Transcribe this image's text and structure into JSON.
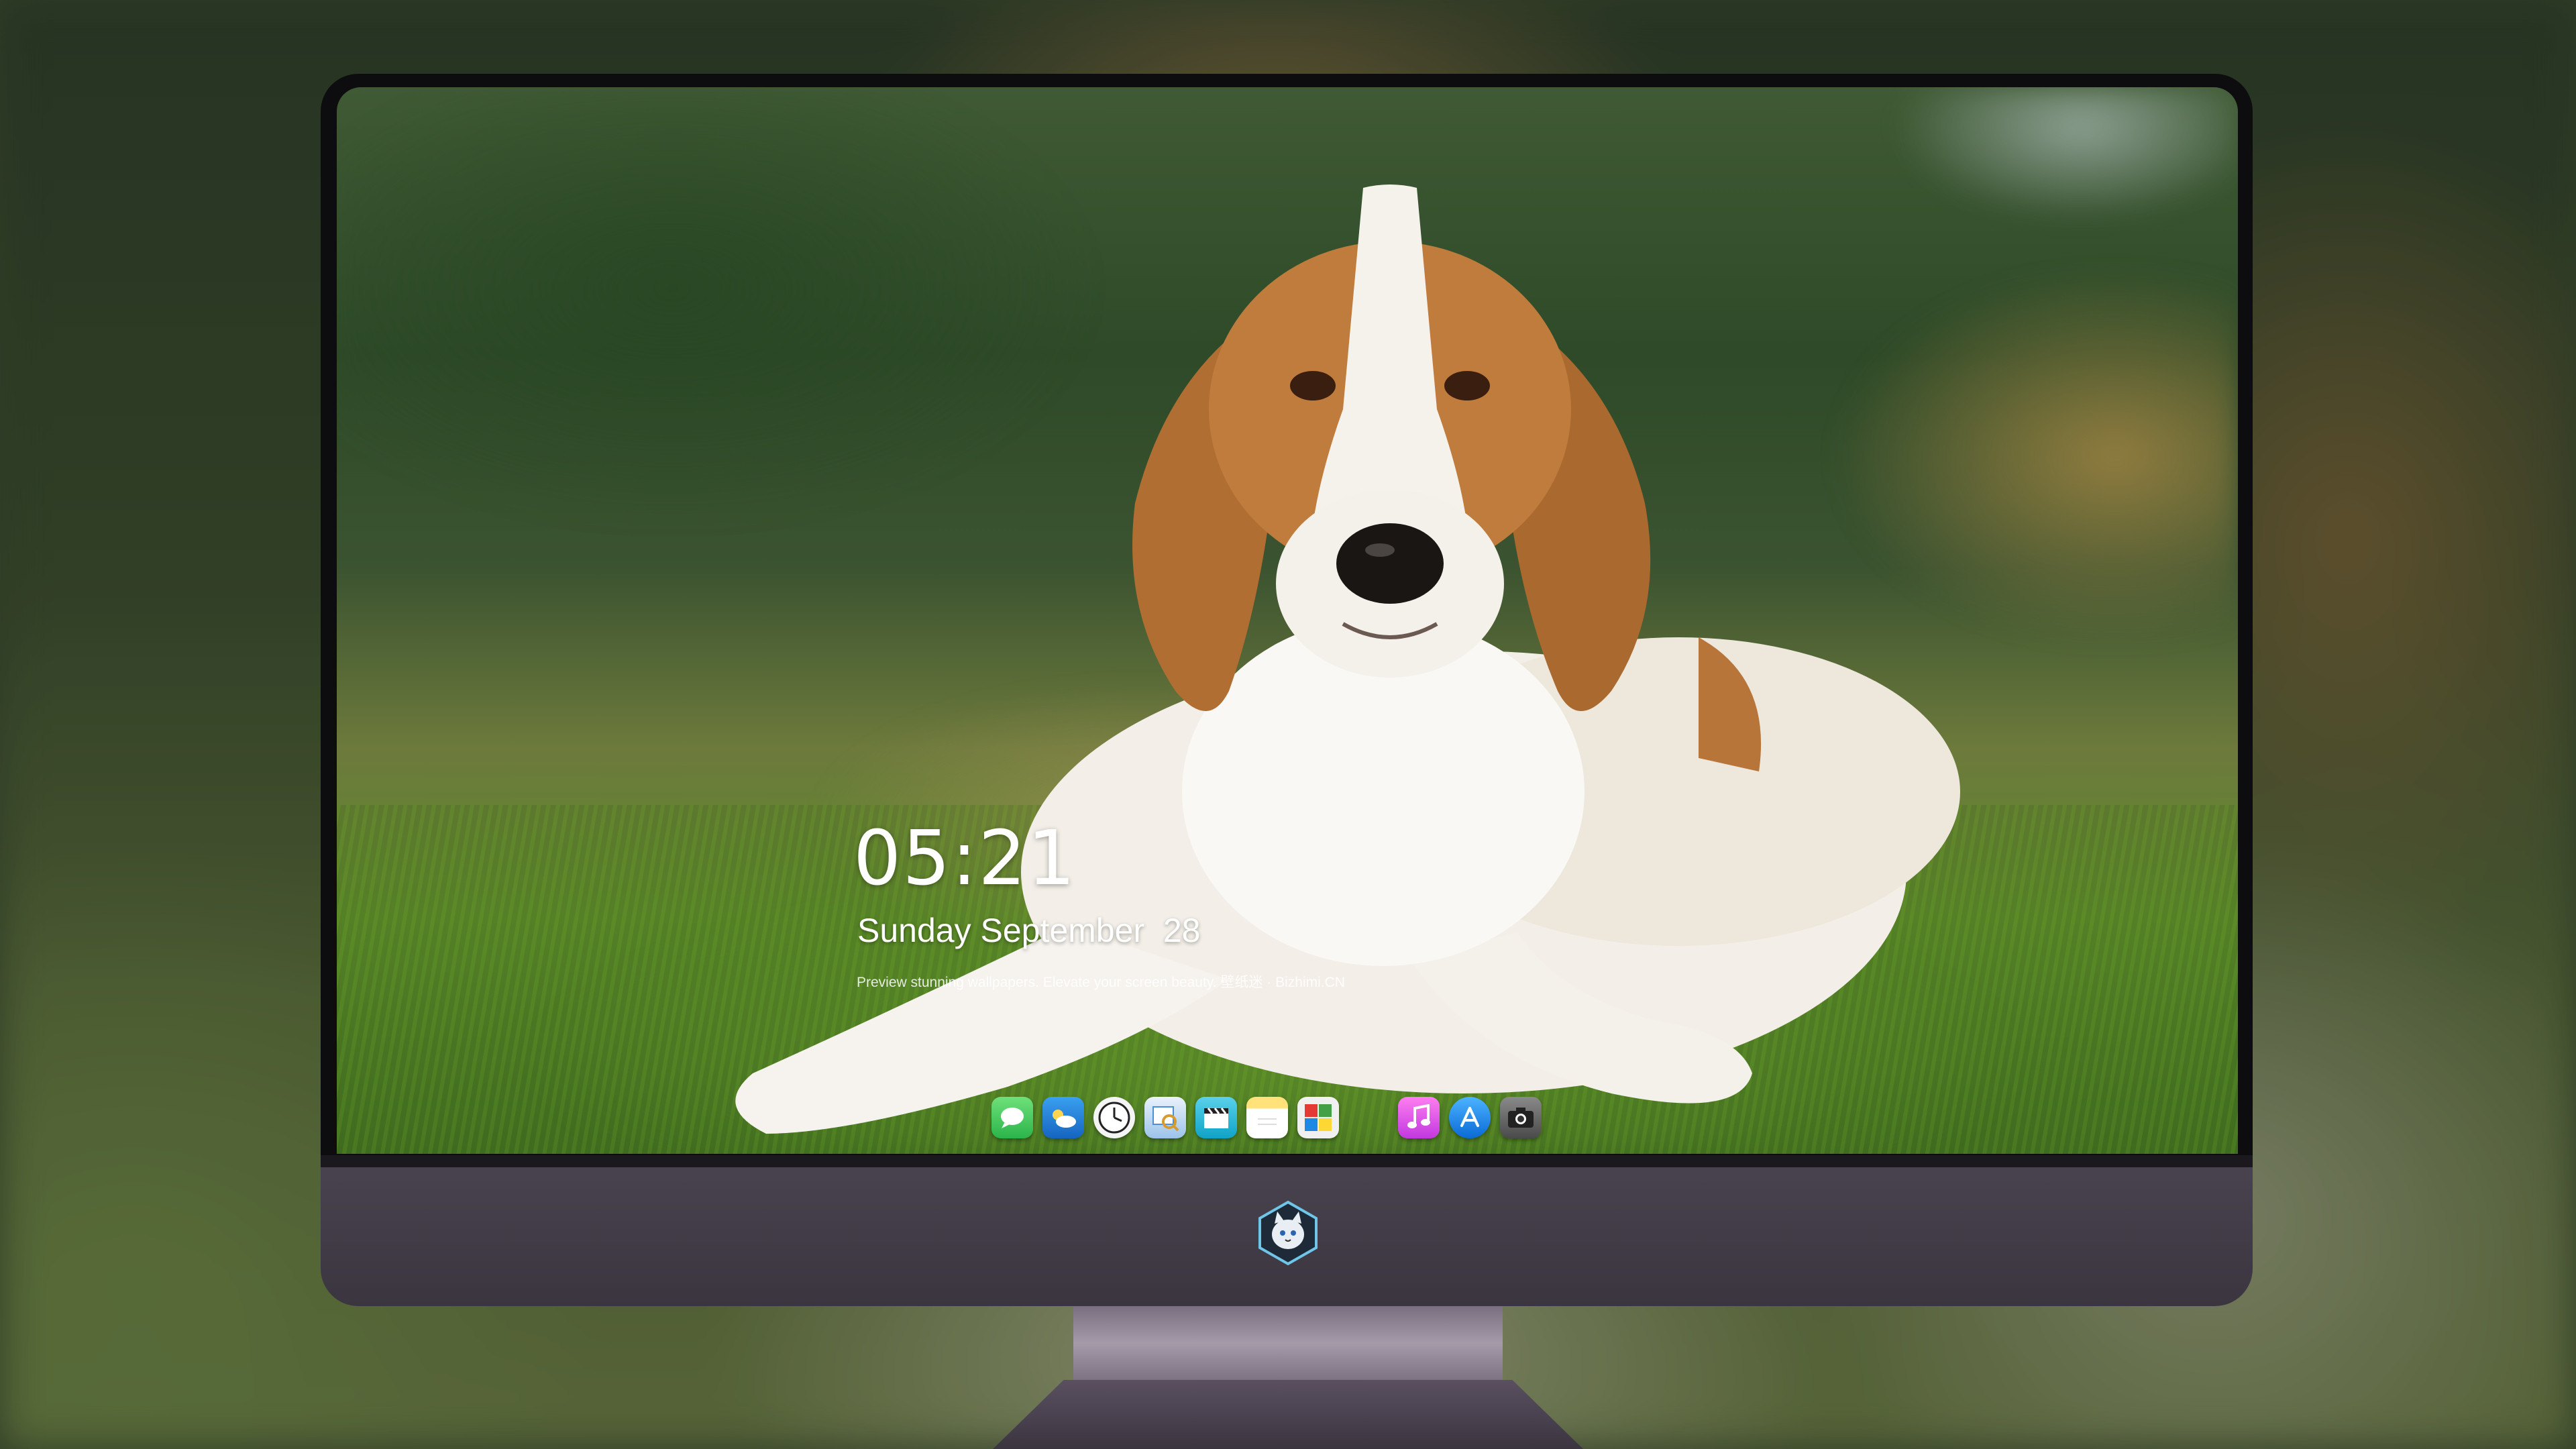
{
  "lock_screen": {
    "time": "05:21",
    "date": "Sunday September  28",
    "tagline": "Preview stunning wallpapers. Elevate your screen beauty. 壁纸迷 · Bizhimi.CN"
  },
  "wallpaper": {
    "subject": "beagle-dog-on-grass"
  },
  "dock": {
    "items": [
      {
        "name": "messages",
        "icon": "speech-bubble-icon",
        "color": "#34c759"
      },
      {
        "name": "weather",
        "icon": "cloud-icon",
        "color": "#1e88e5"
      },
      {
        "name": "clock",
        "icon": "clock-icon",
        "color": "#ffffff"
      },
      {
        "name": "preview",
        "icon": "magnifier-photo-icon",
        "color": "#4a90d9"
      },
      {
        "name": "clips",
        "icon": "clapperboard-icon",
        "color": "#1fb8d6"
      },
      {
        "name": "notes",
        "icon": "notes-icon",
        "color": "#fcd34d"
      },
      {
        "name": "photo-booth",
        "icon": "photo-grid-icon",
        "color": "#e0e0e0"
      },
      {
        "name": "music",
        "icon": "music-note-icon",
        "color": "#e94bd6"
      },
      {
        "name": "app-store",
        "icon": "app-store-a-icon",
        "color": "#1a8cff"
      },
      {
        "name": "camera",
        "icon": "camera-icon",
        "color": "#6b6b6b"
      }
    ]
  },
  "monitor": {
    "logo": "cat-badge-logo"
  }
}
